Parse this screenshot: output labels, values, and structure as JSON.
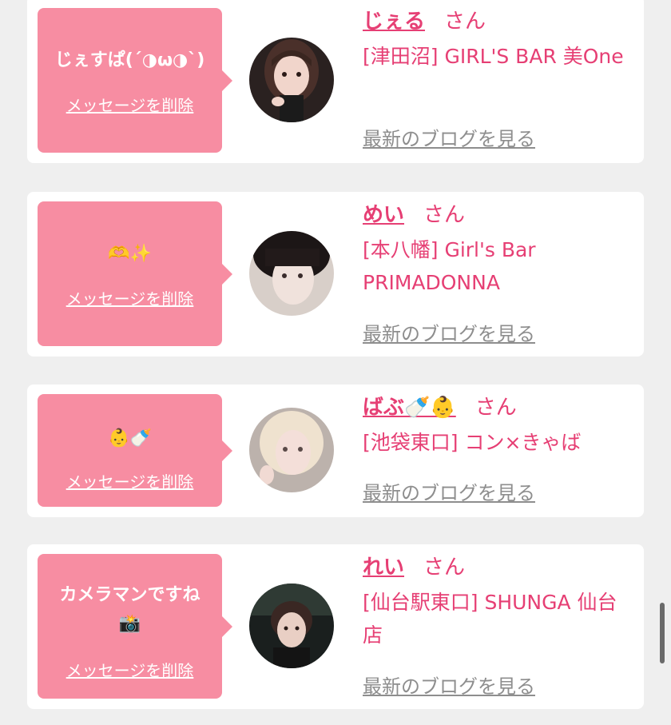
{
  "favorites": [
    {
      "message": "じぇすぱ(´◑ω◑`)",
      "delete_label": "メッセージを削除",
      "name": "じぇる",
      "honorific": "さん",
      "shop": "[津田沼] GIRL'S BAR 美One",
      "blog_label": "最新のブログを見る"
    },
    {
      "message": "🫶✨",
      "delete_label": "メッセージを削除",
      "name": "めい",
      "honorific": "さん",
      "shop": "[本八幡] Girl's Bar PRIMADONNA",
      "blog_label": "最新のブログを見る"
    },
    {
      "message": "👶🍼",
      "delete_label": "メッセージを削除",
      "name": "ばぶ🍼👶",
      "honorific": "さん",
      "shop": "[池袋東口] コン×きゃば",
      "blog_label": "最新のブログを見る"
    },
    {
      "message_line1": "カメラマンですね",
      "message_line2": "📸",
      "delete_label": "メッセージを削除",
      "name": "れい",
      "honorific": "さん",
      "shop": "[仙台駅東口] SHUNGA 仙台店",
      "blog_label": "最新のブログを見る"
    }
  ],
  "colors": {
    "accent": "#e63f74",
    "bubble": "#f78da2",
    "background": "#efefef",
    "muted_link": "#8e8e8e"
  }
}
